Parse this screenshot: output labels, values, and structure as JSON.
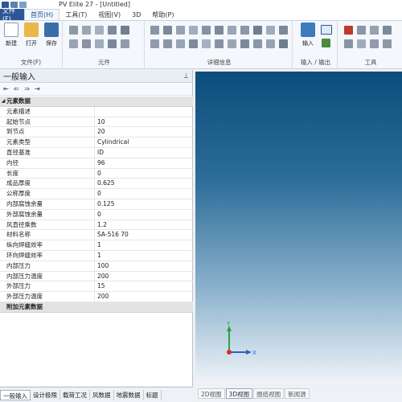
{
  "window": {
    "title": "PV Elite 27 - [Untitled]"
  },
  "ribbon": {
    "tabs": [
      {
        "label": "文件(F)"
      },
      {
        "label": "首页(H)"
      },
      {
        "label": "工具(T)"
      },
      {
        "label": "视图(V)"
      },
      {
        "label": "3D"
      },
      {
        "label": "帮助(P)"
      }
    ],
    "groups": {
      "file": {
        "label": "文件(F)",
        "new_label": "新建",
        "open_label": "打开",
        "save_label": "保存"
      },
      "elements": {
        "label": "元件"
      },
      "details": {
        "label": "详细信息"
      },
      "io": {
        "label": "输入 / 输出",
        "input_label": "输入"
      },
      "tools": {
        "label": "工具"
      }
    },
    "colors": {
      "file_tab": "#2b5797",
      "accent": "#1f4e8c"
    }
  },
  "panel": {
    "title": "一般输入",
    "pin_icon": "pin-icon",
    "toolbar": [
      "first-icon",
      "prev-icon",
      "next-icon",
      "last-icon"
    ],
    "category_main": "元素数据",
    "category_extra": "附加元素数据",
    "rows": [
      {
        "key": "元素描述",
        "value": ""
      },
      {
        "key": "起始节点",
        "value": "10"
      },
      {
        "key": "到节点",
        "value": "20"
      },
      {
        "key": "元素类型",
        "value": "Cylindrical"
      },
      {
        "key": "直径基准",
        "value": "ID"
      },
      {
        "key": "内径",
        "value": "96"
      },
      {
        "key": "长度",
        "value": "0"
      },
      {
        "key": "成品厚度",
        "value": "0.625"
      },
      {
        "key": "公称厚度",
        "value": "0"
      },
      {
        "key": "内部腐蚀余量",
        "value": "0.125"
      },
      {
        "key": "外部腐蚀余量",
        "value": "0"
      },
      {
        "key": "风直径乘数",
        "value": "1.2"
      },
      {
        "key": "材料名称",
        "value": "SA-516 70"
      },
      {
        "key": "纵向焊缝效率",
        "value": "1"
      },
      {
        "key": "环向焊缝效率",
        "value": "1"
      },
      {
        "key": "内部压力",
        "value": "100"
      },
      {
        "key": "内部压力温度",
        "value": "200"
      },
      {
        "key": "外部压力",
        "value": "15"
      },
      {
        "key": "外部压力温度",
        "value": "200"
      }
    ]
  },
  "bottom_tabs": [
    {
      "label": "一般输入"
    },
    {
      "label": "设计极限"
    },
    {
      "label": "载荷工况"
    },
    {
      "label": "风数据"
    },
    {
      "label": "地震数据"
    },
    {
      "label": "标题"
    }
  ],
  "viewport": {
    "axis_x": "X",
    "axis_y": "Y",
    "tabs": [
      {
        "label": "2D视图"
      },
      {
        "label": "3D视图"
      },
      {
        "label": "图纸视图"
      },
      {
        "label": "新闻源"
      }
    ]
  }
}
